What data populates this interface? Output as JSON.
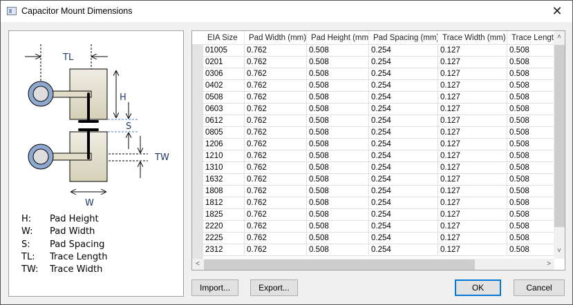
{
  "window": {
    "title": "Capacitor Mount Dimensions",
    "close_icon": "close-icon"
  },
  "diagram": {
    "labels": {
      "tl": "TL",
      "h": "H",
      "s": "S",
      "tw": "TW",
      "w": "W"
    },
    "legend": [
      {
        "key": "H:",
        "desc": "Pad Height"
      },
      {
        "key": "W:",
        "desc": "Pad Width"
      },
      {
        "key": "S:",
        "desc": "Pad Spacing"
      },
      {
        "key": "TL:",
        "desc": "Trace Length"
      },
      {
        "key": "TW:",
        "desc": "Trace Width"
      }
    ]
  },
  "table": {
    "columns": [
      "EIA Size",
      "Pad Width (mm)",
      "Pad Height (mm)",
      "Pad Spacing (mm)",
      "Trace Width (mm)",
      "Trace Length"
    ],
    "rows": [
      [
        "01005",
        "0.762",
        "0.508",
        "0.254",
        "0.127",
        "0.508"
      ],
      [
        "0201",
        "0.762",
        "0.508",
        "0.254",
        "0.127",
        "0.508"
      ],
      [
        "0306",
        "0.762",
        "0.508",
        "0.254",
        "0.127",
        "0.508"
      ],
      [
        "0402",
        "0.762",
        "0.508",
        "0.254",
        "0.127",
        "0.508"
      ],
      [
        "0508",
        "0.762",
        "0.508",
        "0.254",
        "0.127",
        "0.508"
      ],
      [
        "0603",
        "0.762",
        "0.508",
        "0.254",
        "0.127",
        "0.508"
      ],
      [
        "0612",
        "0.762",
        "0.508",
        "0.254",
        "0.127",
        "0.508"
      ],
      [
        "0805",
        "0.762",
        "0.508",
        "0.254",
        "0.127",
        "0.508"
      ],
      [
        "1206",
        "0.762",
        "0.508",
        "0.254",
        "0.127",
        "0.508"
      ],
      [
        "1210",
        "0.762",
        "0.508",
        "0.254",
        "0.127",
        "0.508"
      ],
      [
        "1310",
        "0.762",
        "0.508",
        "0.254",
        "0.127",
        "0.508"
      ],
      [
        "1632",
        "0.762",
        "0.508",
        "0.254",
        "0.127",
        "0.508"
      ],
      [
        "1808",
        "0.762",
        "0.508",
        "0.254",
        "0.127",
        "0.508"
      ],
      [
        "1812",
        "0.762",
        "0.508",
        "0.254",
        "0.127",
        "0.508"
      ],
      [
        "1825",
        "0.762",
        "0.508",
        "0.254",
        "0.127",
        "0.508"
      ],
      [
        "2220",
        "0.762",
        "0.508",
        "0.254",
        "0.127",
        "0.508"
      ],
      [
        "2225",
        "0.762",
        "0.508",
        "0.254",
        "0.127",
        "0.508"
      ],
      [
        "2312",
        "0.762",
        "0.508",
        "0.254",
        "0.127",
        "0.508"
      ]
    ]
  },
  "scroll": {
    "up": "˄",
    "down": "˅",
    "left": "<",
    "right": ">"
  },
  "buttons": {
    "import": "Import...",
    "export": "Export...",
    "ok": "OK",
    "cancel": "Cancel"
  },
  "colors": {
    "accent": "#0078d7",
    "dim_label": "#1f3864",
    "pad": "#e2dcc8",
    "ring": "#8ea9cf"
  }
}
